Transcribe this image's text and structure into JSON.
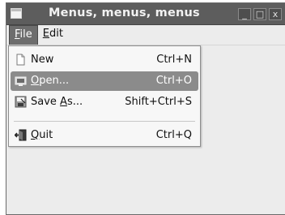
{
  "window": {
    "title": "Menus, menus, menus",
    "buttons": {
      "minimize": "_",
      "maximize": "□",
      "close": "x"
    }
  },
  "menubar": {
    "file": {
      "prefix": "",
      "underlined": "F",
      "rest": "ile"
    },
    "edit": {
      "prefix": "",
      "underlined": "E",
      "rest": "dit"
    }
  },
  "file_menu": {
    "items": [
      {
        "label": "New",
        "underlined": "",
        "accelerator": "Ctrl+N",
        "icon": "new-document-icon"
      },
      {
        "label_underlined": "O",
        "label_rest": "pen...",
        "accelerator": "Ctrl+O",
        "icon": "open-icon",
        "highlighted": true
      },
      {
        "label_prefix": "Save ",
        "label_underlined": "A",
        "label_rest": "s...",
        "accelerator": "Shift+Ctrl+S",
        "icon": "save-as-icon"
      },
      {
        "label_underlined": "Q",
        "label_rest": "uit",
        "accelerator": "Ctrl+Q",
        "icon": "quit-icon"
      }
    ]
  },
  "colors": {
    "titlebar": "#5d5d5d",
    "menu_highlight": "#8b8b8b",
    "window_bg": "#ececec"
  }
}
